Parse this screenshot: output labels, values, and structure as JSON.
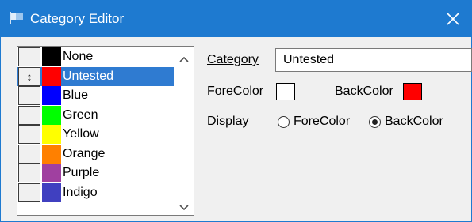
{
  "window": {
    "title": "Category Editor",
    "titlebar_color": "#1e7ad0",
    "close_icon": "close-icon"
  },
  "list": {
    "items": [
      {
        "label": "None",
        "color": "#000000",
        "handle": "",
        "selected": false
      },
      {
        "label": "Untested",
        "color": "#ff0000",
        "handle": "↕",
        "selected": true
      },
      {
        "label": "Blue",
        "color": "#0000ff",
        "handle": "",
        "selected": false
      },
      {
        "label": "Green",
        "color": "#00ff00",
        "handle": "",
        "selected": false
      },
      {
        "label": "Yellow",
        "color": "#ffff00",
        "handle": "",
        "selected": false
      },
      {
        "label": "Orange",
        "color": "#ff8000",
        "handle": "",
        "selected": false
      },
      {
        "label": "Purple",
        "color": "#a040a0",
        "handle": "",
        "selected": false
      },
      {
        "label": "Indigo",
        "color": "#4040c0",
        "handle": "",
        "selected": false
      }
    ],
    "selection_color": "#2f7bd1"
  },
  "form": {
    "category_label": "Category",
    "category_value": "Untested",
    "forecolor_label": "ForeColor",
    "forecolor_value": "#ffffff",
    "backcolor_label": "BackColor",
    "backcolor_value": "#ff0000",
    "display_label": "Display",
    "radio_forecolor": "ForeColor",
    "radio_backcolor": "BackColor",
    "display_selected": "BackColor"
  }
}
